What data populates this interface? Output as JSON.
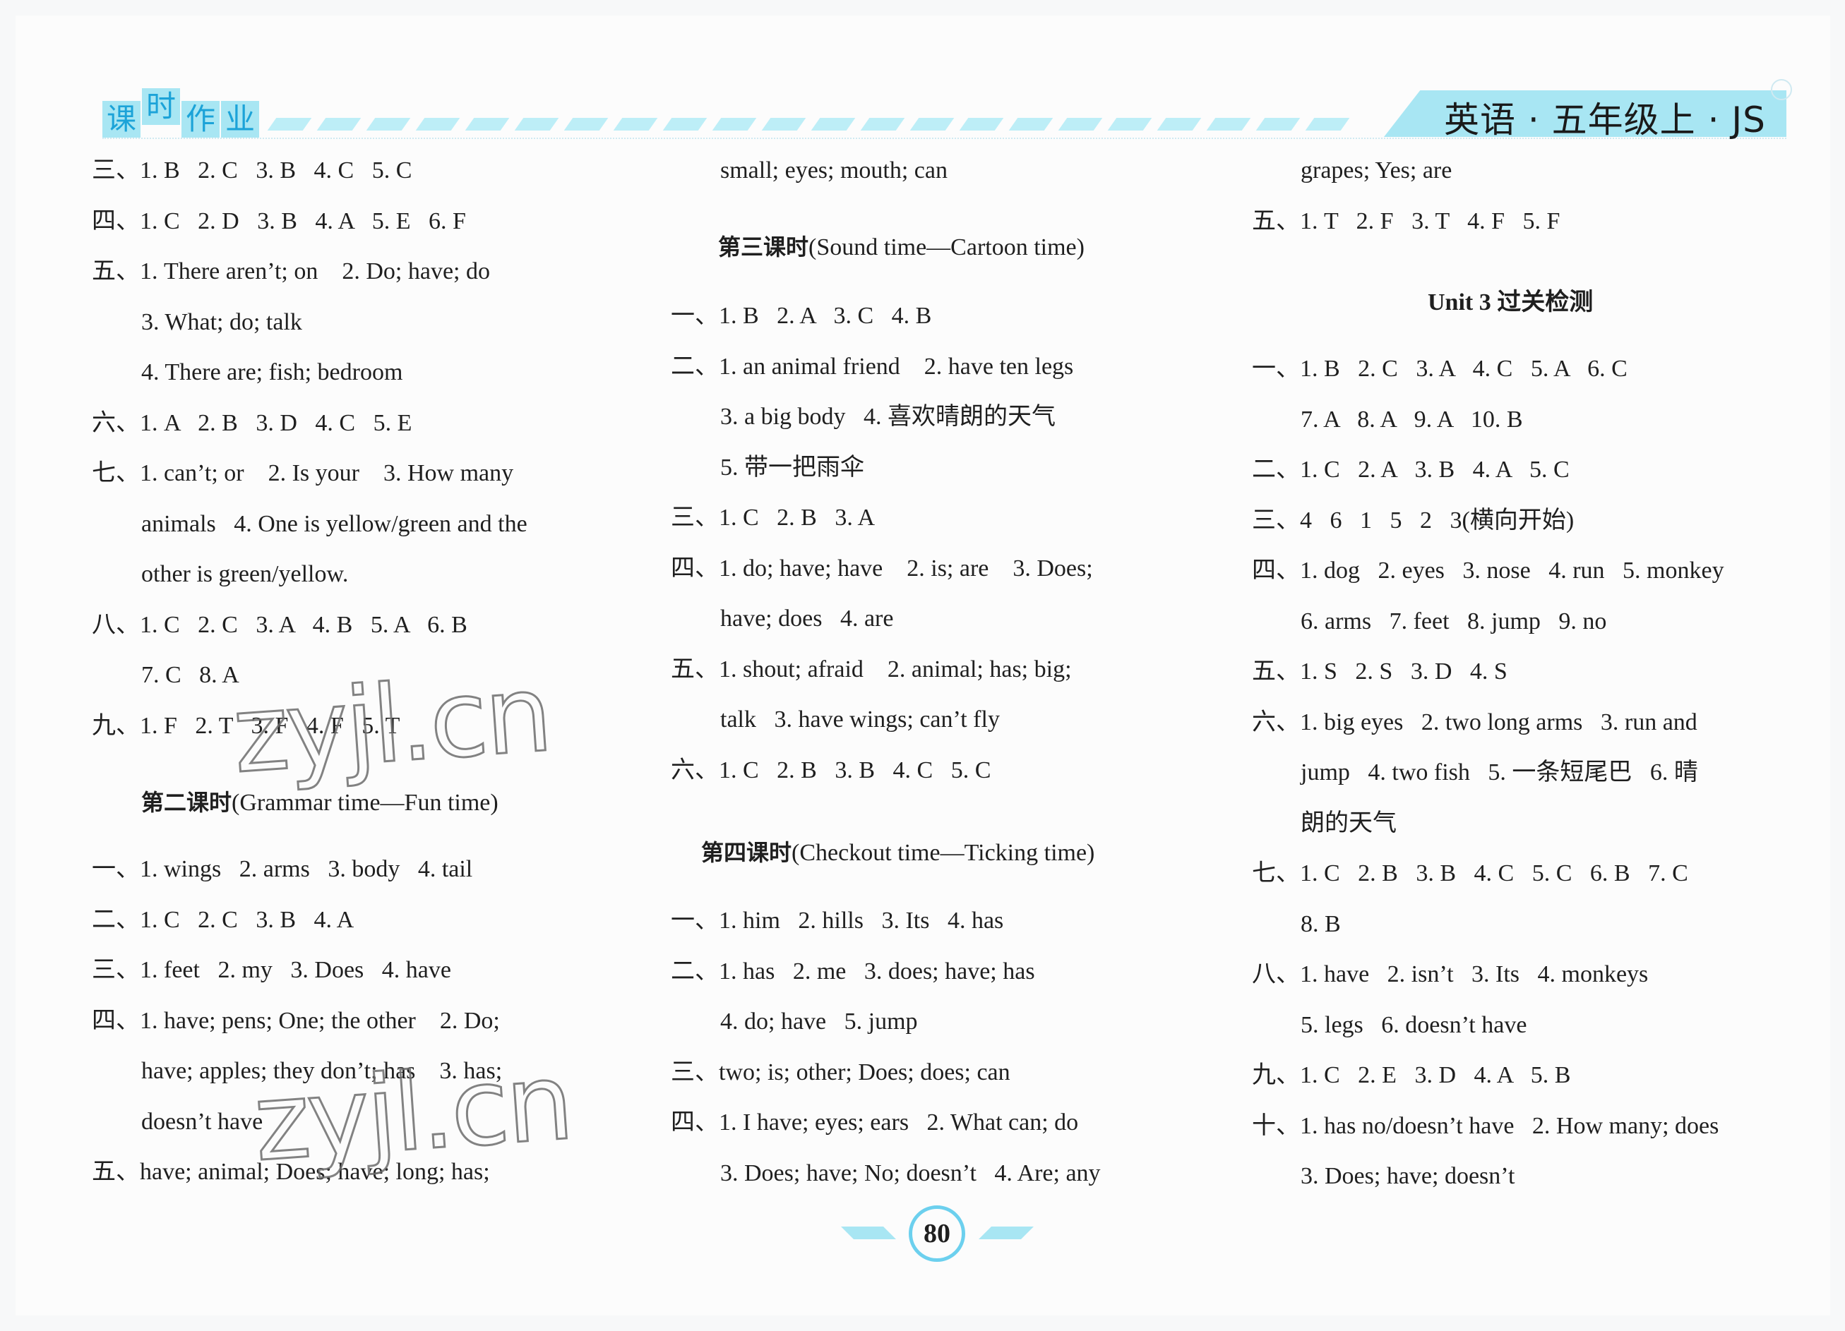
{
  "header": {
    "logo_chars": [
      "课",
      "时",
      "作",
      "业"
    ],
    "subject_banner": "英语 · 五年级上 · JS"
  },
  "columns": [
    {
      "lines": [
        {
          "text": "三、1. B   2. C   3. B   4. C   5. C",
          "indent": false
        },
        {
          "text": "四、1. C   2. D   3. B   4. A   5. E   6. F",
          "indent": false
        },
        {
          "text": "五、1. There aren’t; on    2. Do; have; do",
          "indent": false
        },
        {
          "text": "3. What; do; talk",
          "indent": true
        },
        {
          "text": "4. There are; fish; bedroom",
          "indent": true
        },
        {
          "text": "六、1. A   2. B   3. D   4. C   5. E",
          "indent": false
        },
        {
          "text": "七、1. can’t; or    2. Is your    3. How many",
          "indent": false
        },
        {
          "text": "animals   4. One is yellow/green and the",
          "indent": true
        },
        {
          "text": "other is green/yellow.",
          "indent": true
        },
        {
          "text": "八、1. C   2. C   3. A   4. B   5. A   6. B",
          "indent": false
        },
        {
          "text": "7. C   8. A",
          "indent": true
        },
        {
          "text": "九、1. F   2. T   3. F   4. F   5. T",
          "indent": false
        }
      ],
      "heading": {
        "bold": "第二课时",
        "rest": "(Grammar time—Fun time)"
      },
      "lines2": [
        {
          "text": "一、1. wings   2. arms   3. body   4. tail",
          "indent": false
        },
        {
          "text": "二、1. C   2. C   3. B   4. A",
          "indent": false
        },
        {
          "text": "三、1. feet   2. my   3. Does   4. have",
          "indent": false
        },
        {
          "text": "四、1. have; pens; One; the other    2. Do;",
          "indent": false
        },
        {
          "text": "have; apples; they don’t; has    3. has;",
          "indent": true
        },
        {
          "text": "doesn’t have",
          "indent": true
        },
        {
          "text": "五、have; animal; Does; have; long; has;",
          "indent": false
        }
      ]
    },
    {
      "lines": [
        {
          "text": "small; eyes; mouth; can",
          "indent": true
        }
      ],
      "heading": {
        "bold": "第三课时",
        "rest": "(Sound time—Cartoon time)"
      },
      "lines2": [
        {
          "text": "一、1. B   2. A   3. C   4. B",
          "indent": false
        },
        {
          "text": "二、1. an animal friend    2. have ten legs",
          "indent": false
        },
        {
          "text": "3. a big body   4. 喜欢晴朗的天气",
          "indent": true
        },
        {
          "text": "5. 带一把雨伞",
          "indent": true
        },
        {
          "text": "三、1. C   2. B   3. A",
          "indent": false
        },
        {
          "text": "四、1. do; have; have    2. is; are    3. Does;",
          "indent": false
        },
        {
          "text": "have; does   4. are",
          "indent": true
        },
        {
          "text": "五、1. shout; afraid    2. animal; has; big;",
          "indent": false
        },
        {
          "text": "talk   3. have wings; can’t fly",
          "indent": true
        },
        {
          "text": "六、1. C   2. B   3. B   4. C   5. C",
          "indent": false
        }
      ],
      "heading2": {
        "bold": "第四课时",
        "rest": "(Checkout time—Ticking time)"
      },
      "lines3": [
        {
          "text": "一、1. him   2. hills   3. Its   4. has",
          "indent": false
        },
        {
          "text": "二、1. has   2. me   3. does; have; has",
          "indent": false
        },
        {
          "text": "4. do; have   5. jump",
          "indent": true
        },
        {
          "text": "三、two; is; other; Does; does; can",
          "indent": false
        },
        {
          "text": "四、1. I have; eyes; ears   2. What can; do",
          "indent": false
        },
        {
          "text": "3. Does; have; No; doesn’t   4. Are; any",
          "indent": true
        }
      ]
    },
    {
      "lines": [
        {
          "text": "grapes; Yes; are",
          "indent": true
        },
        {
          "text": "五、1. T   2. F   3. T   4. F   5. F",
          "indent": false
        }
      ],
      "heading": {
        "bold": "Unit 3 过关检测",
        "rest": ""
      },
      "lines2": [
        {
          "text": "一、1. B   2. C   3. A   4. C   5. A   6. C",
          "indent": false
        },
        {
          "text": "7. A   8. A   9. A   10. B",
          "indent": true
        },
        {
          "text": "二、1. C   2. A   3. B   4. A   5. C",
          "indent": false
        },
        {
          "text": "三、4   6   1   5   2   3(横向开始)",
          "indent": false
        },
        {
          "text": "四、1. dog   2. eyes   3. nose   4. run   5. monkey",
          "indent": false
        },
        {
          "text": "6. arms   7. feet   8. jump   9. no",
          "indent": true
        },
        {
          "text": "五、1. S   2. S   3. D   4. S",
          "indent": false
        },
        {
          "text": "六、1. big eyes   2. two long arms   3. run and",
          "indent": false
        },
        {
          "text": "jump   4. two fish   5. 一条短尾巴   6. 晴",
          "indent": true
        },
        {
          "text": "朗的天气",
          "indent": true
        },
        {
          "text": "七、1. C   2. B   3. B   4. C   5. C   6. B   7. C",
          "indent": false
        },
        {
          "text": "8. B",
          "indent": true
        },
        {
          "text": "八、1. have   2. isn’t   3. Its   4. monkeys",
          "indent": false
        },
        {
          "text": "5. legs   6. doesn’t have",
          "indent": true
        },
        {
          "text": "九、1. C   2. E   3. D   4. A   5. B",
          "indent": false
        },
        {
          "text": "十、1. has no/doesn’t have   2. How many; does",
          "indent": false
        },
        {
          "text": "3. Does; have; doesn’t",
          "indent": true
        }
      ]
    }
  ],
  "watermarks": [
    "zyjl.cn",
    "zyjl.cn"
  ],
  "footer": {
    "page_number": "80"
  },
  "colors": {
    "accent_light": "#a8e6f3",
    "accent": "#1ca3d8",
    "ring": "#6cd0ee"
  }
}
